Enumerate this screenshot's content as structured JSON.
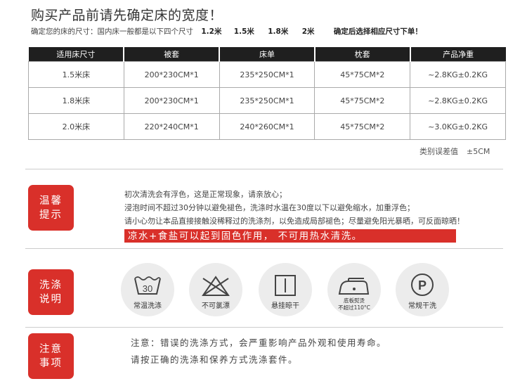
{
  "title": "购买产品前请先确定床的宽度！",
  "intro": {
    "text": "确定您的床的尺寸：国内床一般都是以下四个尺寸",
    "sizes": [
      "1.2米",
      "1.5米",
      "1.8米",
      "2米"
    ],
    "tip": "确定后选择相应尺寸下单！"
  },
  "size_table": {
    "headers": [
      "适用床尺寸",
      "被套",
      "床单",
      "枕套",
      "产品净重"
    ],
    "rows": [
      [
        "1.5米床",
        "200*230CM*1",
        "235*250CM*1",
        "45*75CM*2",
        "~2.8KG±0.2KG"
      ],
      [
        "1.8米床",
        "200*230CM*1",
        "235*250CM*1",
        "45*75CM*2",
        "~2.8KG±0.2KG"
      ],
      [
        "2.0米床",
        "220*240CM*1",
        "240*260CM*1",
        "45*75CM*2",
        "~3.0KG±0.2KG"
      ]
    ]
  },
  "tolerance": {
    "label": "类别误差值",
    "value": "±5CM"
  },
  "reminder": {
    "badge": [
      "温馨",
      "提示"
    ],
    "notes": [
      "初次清洗会有浮色，这是正常现象，请亲放心；",
      "浸泡时间不超过30分钟以避免褪色，洗涤时水温在30度以下以避免缩水，加重浮色；",
      "请小心勿让本品直接接触没稀释过的洗涤剂，以免造成局部褪色；尽量避免阳光暴晒，可反面晾晒！"
    ],
    "highlight": "凉水+食盐可以起到固色作用， 不可用热水清洗。"
  },
  "washing": {
    "badge": [
      "洗涤",
      "说明"
    ],
    "icons": [
      {
        "icon": "wash-30-icon",
        "label": "常温洗涤",
        "symbol_text": "30"
      },
      {
        "icon": "no-bleach-icon",
        "label": "不可氯漂"
      },
      {
        "icon": "hang-dry-icon",
        "label": "悬挂晾干"
      },
      {
        "icon": "iron-icon",
        "label": "底板熨烫",
        "label2": "不超过110°C"
      },
      {
        "icon": "dry-clean-p-icon",
        "label": "常规干洗",
        "symbol_text": "P"
      }
    ]
  },
  "caution": {
    "badge": [
      "注意",
      "事项"
    ],
    "lines": [
      "注意：错误的洗涤方式，会严重影响产品外观和使用寿命。",
      "请按正确的洗涤和保养方式洗涤套件。"
    ]
  },
  "colors": {
    "accent": "#d9302a",
    "table_header": "#1f1f1f"
  }
}
